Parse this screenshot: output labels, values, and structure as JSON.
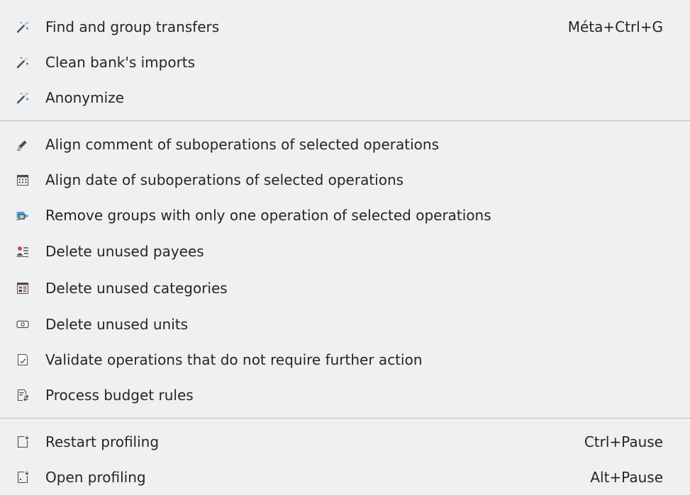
{
  "menu": {
    "items": [
      {
        "label": "Find and group transfers",
        "shortcut": "Méta+Ctrl+G",
        "icon": "magic-wand-icon"
      },
      {
        "label": "Clean bank's imports",
        "shortcut": "",
        "icon": "magic-wand-clean-icon"
      },
      {
        "label": "Anonymize",
        "shortcut": "",
        "icon": "magic-wand-anonymize-icon"
      },
      {
        "label": "Align comment of suboperations of selected operations",
        "shortcut": "",
        "icon": "edit-pen-icon"
      },
      {
        "label": "Align date of suboperations of selected operations",
        "shortcut": "",
        "icon": "calendar-icon"
      },
      {
        "label": "Remove groups with only one operation of selected operations",
        "shortcut": "",
        "icon": "ungroup-icon"
      },
      {
        "label": "Delete unused payees",
        "shortcut": "",
        "icon": "payee-icon"
      },
      {
        "label": "Delete unused categories",
        "shortcut": "",
        "icon": "categories-icon"
      },
      {
        "label": "Delete unused units",
        "shortcut": "",
        "icon": "unit-icon"
      },
      {
        "label": "Validate operations that do not require further action",
        "shortcut": "",
        "icon": "validate-icon"
      },
      {
        "label": "Process budget rules",
        "shortcut": "",
        "icon": "budget-rules-icon"
      },
      {
        "label": "Restart profiling",
        "shortcut": "Ctrl+Pause",
        "icon": "restart-profiling-icon"
      },
      {
        "label": "Open profiling",
        "shortcut": "Alt+Pause",
        "icon": "open-profiling-icon"
      }
    ]
  },
  "colors": {
    "background": "#eff0f1",
    "text": "#232629",
    "separator": "#bcbebf"
  }
}
